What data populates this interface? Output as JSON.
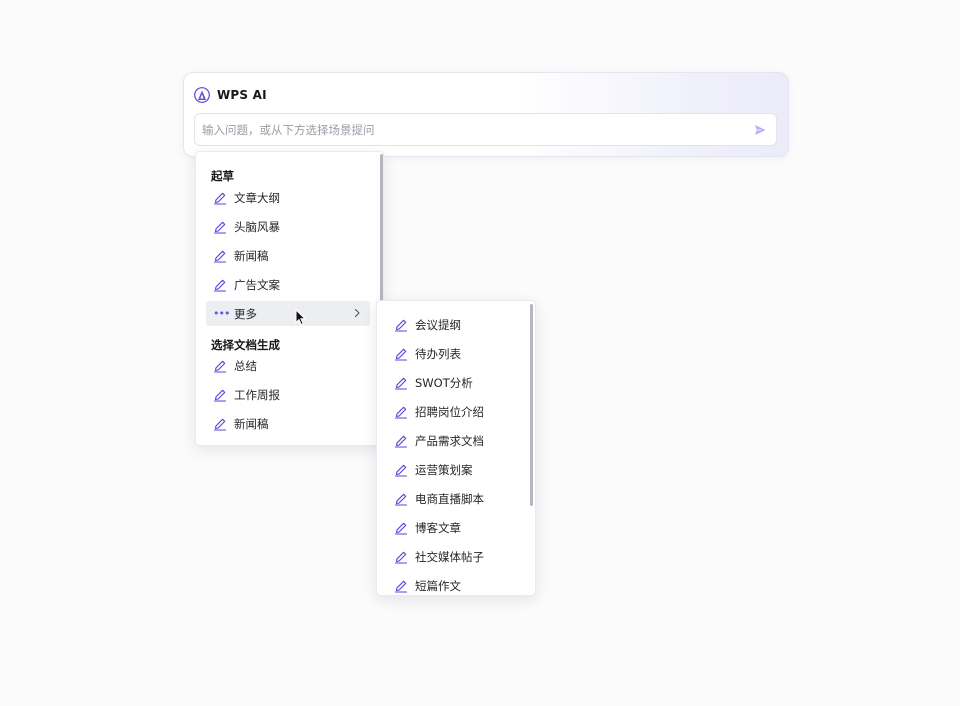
{
  "panel": {
    "title": "WPS AI",
    "logo_icon": "wps-ai-logo-icon",
    "input_value": "",
    "input_placeholder": "输入问题，或从下方选择场景提问",
    "send_icon": "send-icon"
  },
  "menu": {
    "groups": [
      {
        "title": "起草",
        "items": [
          "文章大纲",
          "头脑风暴",
          "新闻稿",
          "广告文案"
        ]
      },
      {
        "title": "选择文档生成",
        "items": [
          "总结",
          "工作周报",
          "新闻稿"
        ]
      }
    ],
    "more": {
      "label": "更多",
      "icon": "more-dots-icon",
      "chevron_icon": "chevron-right-icon"
    }
  },
  "submenu": {
    "items": [
      "会议提纲",
      "待办列表",
      "SWOT分析",
      "招聘岗位介绍",
      "产品需求文档",
      "运营策划案",
      "电商直播脚本",
      "博客文章",
      "社交媒体帖子",
      "短篇作文"
    ]
  },
  "colors": {
    "accent": "#6a4ff0",
    "item_icon": "#5b3fd9",
    "hover_bg": "#eceef2",
    "send_icon": "#b3b0f5"
  },
  "icons": {
    "item": "pen-icon",
    "cursor": "mouse-pointer-icon"
  }
}
